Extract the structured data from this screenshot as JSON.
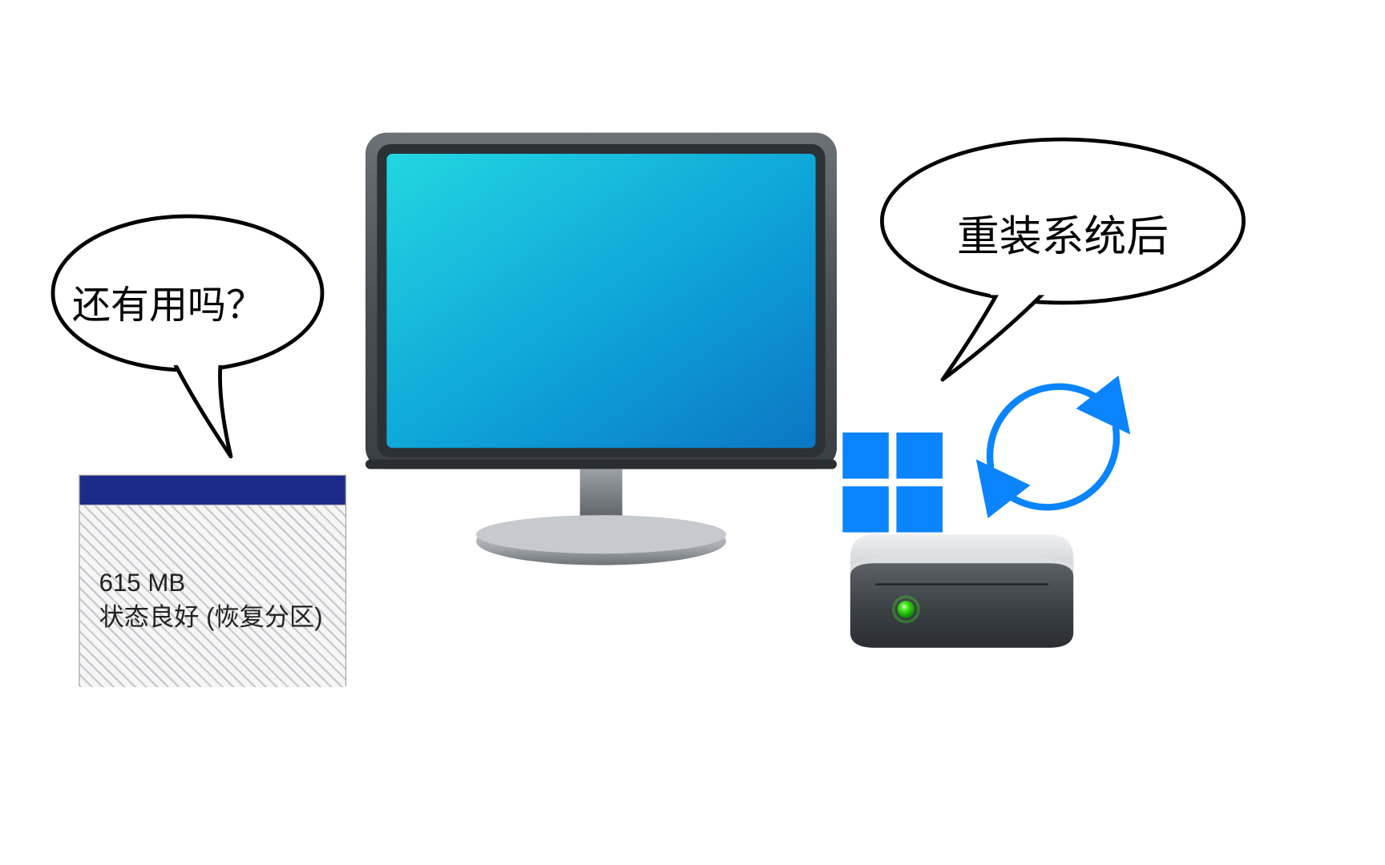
{
  "bubble_left_text": "还有用吗？",
  "bubble_right_text": "重装系统后",
  "partition": {
    "size": "615 MB",
    "status": "状态良好 (恢复分区)"
  },
  "colors": {
    "accent_blue": "#0a84ff",
    "win_blue": "#0078d4",
    "partition_header": "#1e2a8a",
    "drive_led": "#2dd10f"
  }
}
